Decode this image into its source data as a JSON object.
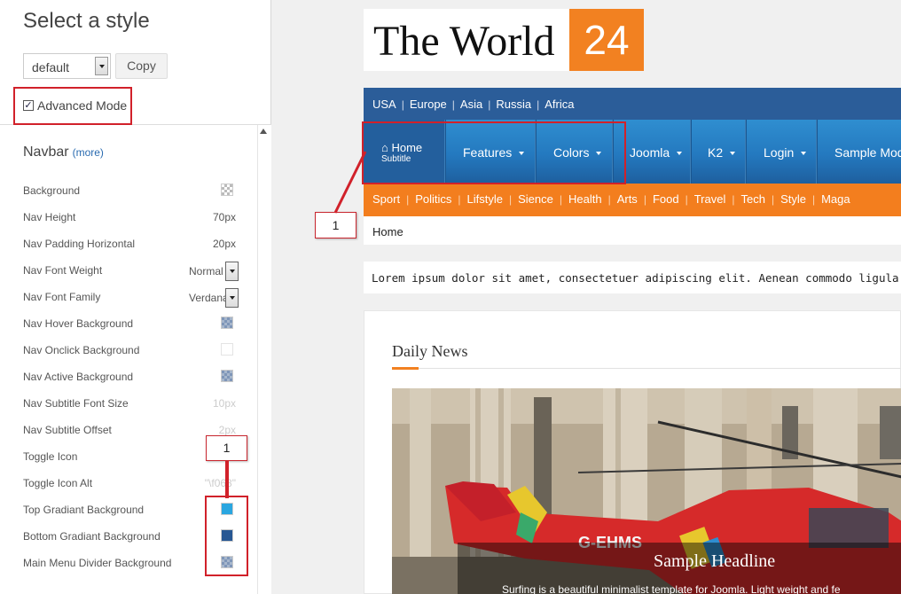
{
  "panel": {
    "title": "Select a style",
    "style_select_value": "default",
    "copy_label": "Copy",
    "advanced_mode_label": "Advanced Mode",
    "section_title": "Navbar",
    "section_more": "(more)",
    "properties": [
      {
        "label": "Background",
        "kind": "swatch",
        "swatch": "checker"
      },
      {
        "label": "Nav Height",
        "kind": "text",
        "value": "70px"
      },
      {
        "label": "Nav Padding Horizontal",
        "kind": "text",
        "value": "20px"
      },
      {
        "label": "Nav Font Weight",
        "kind": "select",
        "value": "Normal"
      },
      {
        "label": "Nav Font Family",
        "kind": "select",
        "value": "Verdana"
      },
      {
        "label": "Nav Hover Background",
        "kind": "swatch",
        "swatch": "checker-blue"
      },
      {
        "label": "Nav Onclick Background",
        "kind": "swatch",
        "swatch": "empty"
      },
      {
        "label": "Nav Active Background",
        "kind": "swatch",
        "swatch": "checker-blue"
      },
      {
        "label": "Nav Subtitle Font Size",
        "kind": "text",
        "value": "10px",
        "faded": true
      },
      {
        "label": "Nav Subtitle Offset",
        "kind": "text",
        "value": "2px",
        "faded": true
      },
      {
        "label": "Toggle Icon",
        "kind": "none"
      },
      {
        "label": "Toggle Icon Alt",
        "kind": "text",
        "value": "\"\\f068\"",
        "faded": true
      },
      {
        "label": "Top Gradiant Background",
        "kind": "swatch",
        "swatch": "#2aa6e0"
      },
      {
        "label": "Bottom Gradiant Background",
        "kind": "swatch",
        "swatch": "#275793"
      },
      {
        "label": "Main Menu Divider Background",
        "kind": "swatch",
        "swatch": "checker-blue"
      }
    ]
  },
  "annotations": {
    "callout_nav": "1",
    "callout_colors": "1"
  },
  "site": {
    "logo_text": "The World",
    "logo_number": "24",
    "top_links": [
      "USA",
      "Europe",
      "Asia",
      "Russia",
      "Africa"
    ],
    "top_sep": "|",
    "nav": {
      "home_label": "Home",
      "home_subtitle": "Subtitle",
      "items": [
        "Features",
        "Colors",
        "Joomla",
        "K2",
        "Login",
        "Sample Mod"
      ]
    },
    "categories": [
      "Sport",
      "Politics",
      "Lifstyle",
      "Sience",
      "Health",
      "Arts",
      "Food",
      "Travel",
      "Tech",
      "Style",
      "Maga"
    ],
    "breadcrumb": "Home",
    "lorem": "Lorem ipsum dolor sit amet, consectetuer adipiscing elit. Aenean commodo ligula eget dolo",
    "section_title": "Daily News",
    "helicopter_reg": "G-EHMS",
    "headline": "Sample Headline",
    "headline_sub": "Surfing is a beautiful minimalist template for Joomla. Light weight and fe"
  },
  "colors": {
    "brand_orange": "#f28121",
    "nav_blue_top": "#2f8ed0",
    "nav_blue_bottom": "#1e5f9e",
    "top_bar_blue": "#2b5d99",
    "annotation_red": "#d1212a"
  }
}
